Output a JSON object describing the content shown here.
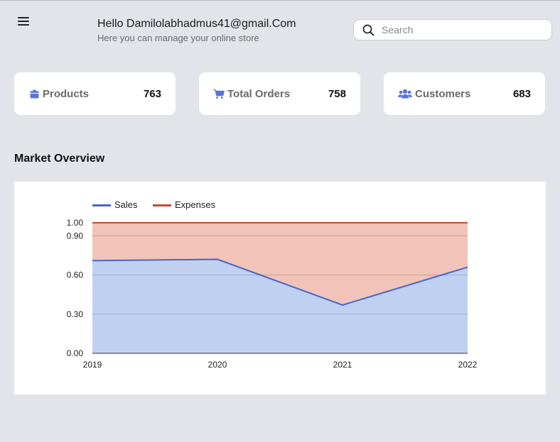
{
  "header": {
    "greeting": "Hello Damilolabhadmus41@gmail.Com",
    "subtitle": "Here you can manage your online store",
    "menu_icon": "hamburger-icon"
  },
  "search": {
    "placeholder": "Search",
    "value": "",
    "icon": "search-icon"
  },
  "stats": [
    {
      "icon": "box-icon",
      "label": "Products",
      "value": "763"
    },
    {
      "icon": "cart-icon",
      "label": "Total Orders",
      "value": "758"
    },
    {
      "icon": "users-icon",
      "label": "Customers",
      "value": "683"
    }
  ],
  "colors": {
    "accent": "#4f6fd8",
    "sales_line": "#4466cc",
    "sales_fill": "#c0d0f0",
    "expenses_line": "#cc4a2c",
    "expenses_fill": "#f2c3b8"
  },
  "market": {
    "title": "Market Overview"
  },
  "chart_data": {
    "type": "area",
    "title": "",
    "xlabel": "",
    "ylabel": "",
    "categories": [
      "2019",
      "2020",
      "2021",
      "2022"
    ],
    "series": [
      {
        "name": "Sales",
        "values": [
          0.71,
          0.72,
          0.37,
          0.66
        ]
      },
      {
        "name": "Expenses",
        "values": [
          1.0,
          1.0,
          1.0,
          1.0
        ]
      }
    ],
    "ylim": [
      0,
      1
    ],
    "yticks": [
      "0.00",
      "0.30",
      "0.60",
      "0.90",
      "1.00"
    ],
    "ytick_values": [
      0,
      0.3,
      0.6,
      0.9,
      1.0
    ],
    "grid": true,
    "legend_position": "top-left"
  }
}
